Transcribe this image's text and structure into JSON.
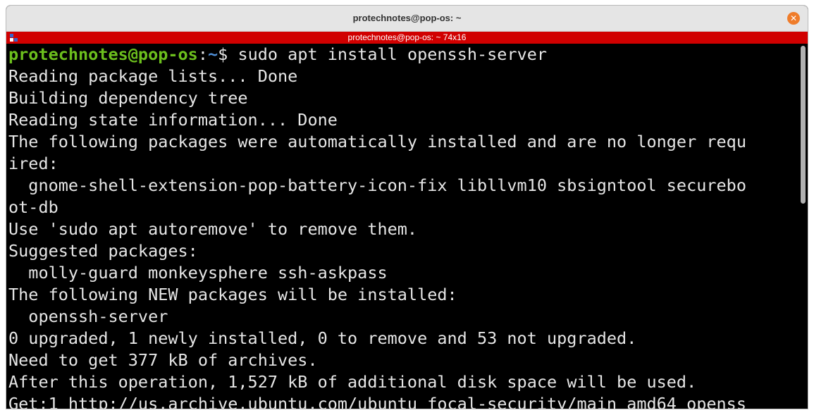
{
  "window": {
    "title": "protechnotes@pop-os: ~",
    "close_glyph": "✕"
  },
  "tabbar": {
    "title": "protechnotes@pop-os: ~ 74x16"
  },
  "prompt": {
    "user_host": "protechnotes@pop-os",
    "separator": ":",
    "path": "~",
    "symbol": "$ ",
    "command": "sudo apt install openssh-server"
  },
  "output_lines": [
    "Reading package lists... Done",
    "Building dependency tree",
    "Reading state information... Done",
    "The following packages were automatically installed and are no longer requ",
    "ired:",
    "  gnome-shell-extension-pop-battery-icon-fix libllvm10 sbsigntool securebo",
    "ot-db",
    "Use 'sudo apt autoremove' to remove them.",
    "Suggested packages:",
    "  molly-guard monkeysphere ssh-askpass",
    "The following NEW packages will be installed:",
    "  openssh-server",
    "0 upgraded, 1 newly installed, 0 to remove and 53 not upgraded.",
    "Need to get 377 kB of archives.",
    "After this operation, 1,527 kB of additional disk space will be used.",
    "Get:1 http://us.archive.ubuntu.com/ubuntu focal-security/main amd64 openss"
  ],
  "colors": {
    "titlebar": "#e5e5e5",
    "tabbar": "#d10000",
    "background": "#000000",
    "text": "#e6e6e6",
    "prompt_user": "#6cbf1d",
    "prompt_path": "#4f8fd8",
    "close_button": "#ef7c2a"
  },
  "icons": {
    "close": "close-icon",
    "terminal_menu": "terminal-menu-icon"
  }
}
